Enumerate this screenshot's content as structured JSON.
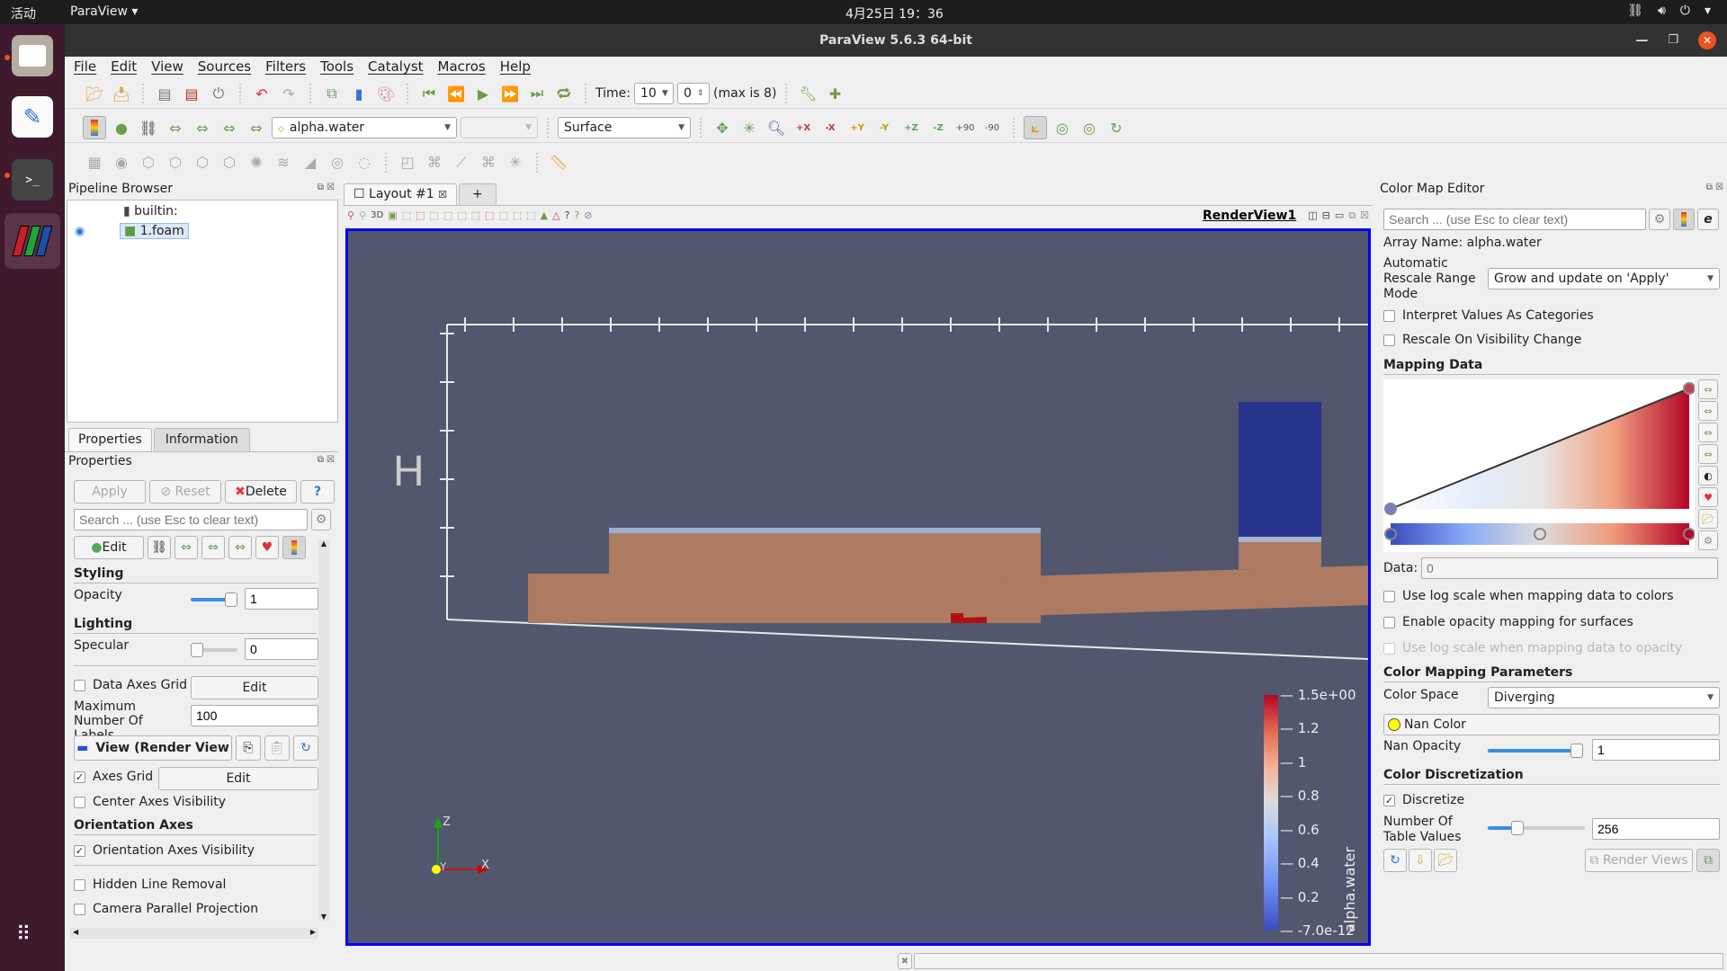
{
  "topbar": {
    "activities": "活动",
    "app_menu": "ParaView ▾",
    "clock": "4月25日  19：36",
    "tray_icons": [
      "network-icon",
      "volume-icon",
      "power-icon",
      "dropdown-icon"
    ]
  },
  "window": {
    "title": "ParaView 5.6.3 64-bit"
  },
  "menu": [
    "File",
    "Edit",
    "View",
    "Sources",
    "Filters",
    "Tools",
    "Catalyst",
    "Macros",
    "Help"
  ],
  "time_toolbar": {
    "label": "Time:",
    "time_value": "10",
    "step_value": "0",
    "max_label": "(max is 8)"
  },
  "display_toolbar": {
    "array": "alpha.water",
    "component": "",
    "representation": "Surface"
  },
  "camera_toolbar": {
    "labels": [
      "+X",
      "-X",
      "+Y",
      "-Y",
      "+Z",
      "-Z",
      "+90",
      "-90"
    ]
  },
  "viewtb_3d": "3D",
  "pipeline": {
    "title": "Pipeline Browser",
    "items": [
      {
        "label": "builtin:",
        "icon": "server-icon"
      },
      {
        "label": "1.foam",
        "icon": "foam-source-icon",
        "visible": true
      }
    ]
  },
  "props": {
    "tabs": [
      "Properties",
      "Information"
    ],
    "title": "Properties",
    "apply": "Apply",
    "reset": "Reset",
    "delete": "Delete",
    "help": "?",
    "search_placeholder": "Search ... (use Esc to clear text)",
    "edit": "Edit",
    "styling": "Styling",
    "opacity_label": "Opacity",
    "opacity_value": "1",
    "opacity_fraction": 1.0,
    "lighting": "Lighting",
    "specular_label": "Specular",
    "specular_value": "0",
    "specular_fraction": 0.0,
    "data_axes_grid": "Data Axes Grid",
    "data_axes_grid_checked": false,
    "data_axes_edit": "Edit",
    "max_labels_label": "Maximum Number Of Labels",
    "max_labels_value": "100",
    "view_section": "View (Render View",
    "axes_grid": "Axes Grid",
    "axes_grid_checked": true,
    "axes_edit": "Edit",
    "center_axes": "Center Axes Visibility",
    "orientation_section": "Orientation Axes",
    "orientation_vis": "Orientation Axes Visibility",
    "hidden_line": "Hidden Line Removal",
    "camera_parallel": "Camera Parallel Projection"
  },
  "layout": {
    "tab": "Layout #1",
    "add_tab": "+",
    "view_name": "RenderView1"
  },
  "render": {
    "axis_label_h": "H",
    "orientation": {
      "z": "Z",
      "y": "Y",
      "x": "X"
    },
    "colorbar": {
      "title": "alpha.water",
      "ticks": [
        "1.5e+00",
        "1.2",
        "1",
        "0.8",
        "0.6",
        "0.4",
        "0.2",
        "-7.0e-12"
      ],
      "range": [
        -7e-12,
        1.5
      ]
    }
  },
  "cme": {
    "title": "Color Map Editor",
    "search_placeholder": "Search ... (use Esc to clear text)",
    "array_name": "Array Name: alpha.water",
    "rescale_label": "Automatic Rescale Range Mode",
    "rescale_value": "Grow and update on 'Apply'",
    "interpret_categories": "Interpret Values As Categories",
    "rescale_visibility": "Rescale On Visibility Change",
    "mapping_data": "Mapping Data",
    "data_label": "Data:",
    "data_placeholder": "0",
    "log_colors": "Use log scale when mapping data to colors",
    "opacity_mapping": "Enable opacity mapping for surfaces",
    "log_opacity": "Use log scale when mapping data to opacity",
    "color_params": "Color Mapping Parameters",
    "color_space_label": "Color Space",
    "color_space": "Diverging",
    "nan_color": "Nan Color",
    "nan_color_hex": "#ffff00",
    "nan_opacity_label": "Nan Opacity",
    "nan_opacity": "1",
    "nan_opacity_fraction": 1.0,
    "discretization": "Color Discretization",
    "discretize": "Discretize",
    "discretize_checked": true,
    "table_values_label": "Number Of Table Values",
    "table_values": "256",
    "table_values_fraction": 0.28,
    "render_views": "Render Views"
  },
  "colors": {
    "render_bg": "#52576e",
    "cool": "#3b4cc0",
    "warm": "#b40426",
    "accent_border": "#0000ff"
  }
}
